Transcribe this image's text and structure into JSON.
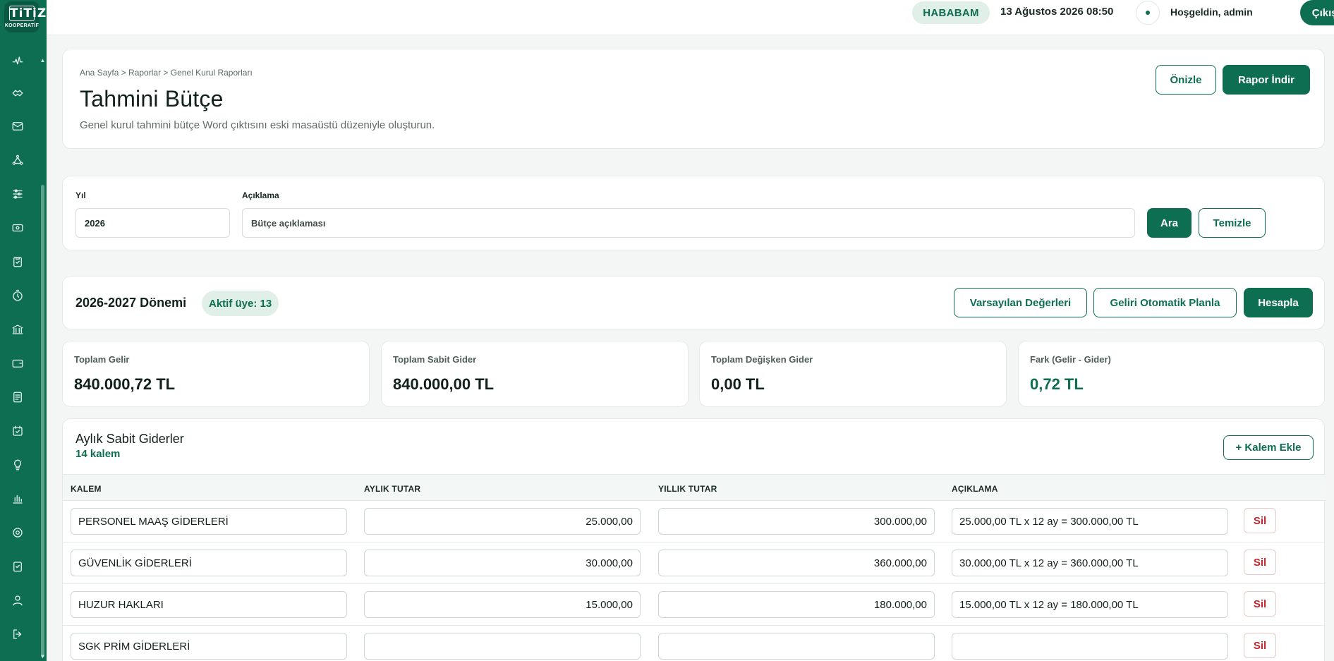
{
  "brand": {
    "logo_text": "TiTiZ",
    "logo_sub": "KOOPERATİF"
  },
  "sidebar": {
    "icons": [
      "activity-icon",
      "handshake-icon",
      "mail-icon",
      "network-icon",
      "sliders-icon",
      "money-icon",
      "clipboard-check-icon",
      "timer-icon",
      "bank-icon",
      "wallet-icon",
      "document-icon",
      "calendar-check-icon",
      "lightbulb-icon",
      "bar-chart-icon",
      "settings-icon",
      "task-icon",
      "user-icon",
      "logout-icon"
    ]
  },
  "topbar": {
    "org": "HABABAM",
    "datetime": "13 Ağustos 2026 08:50",
    "welcome": "Hoşgeldin, admin",
    "logout_label": "Çıkış Yap"
  },
  "header": {
    "breadcrumb": "Ana Sayfa > Raporlar > Genel Kurul Raporları",
    "title": "Tahmini Bütçe",
    "description": "Genel kurul tahmini bütçe Word çıktısını eski masaüstü düzeniyle oluşturun.",
    "preview_label": "Önizle",
    "download_label": "Rapor İndir"
  },
  "filters": {
    "year_label": "Yıl",
    "year_value": "2026",
    "desc_label": "Açıklama",
    "desc_placeholder": "Bütçe açıklaması",
    "search_label": "Ara",
    "clear_label": "Temizle"
  },
  "period": {
    "title": "2026-2027 Dönemi",
    "members_badge": "Aktif üye: 13",
    "defaults_label": "Varsayılan Değerleri",
    "auto_plan_label": "Geliri Otomatik Planla",
    "calculate_label": "Hesapla"
  },
  "stats": [
    {
      "label": "Toplam Gelir",
      "value": "840.000,72 TL"
    },
    {
      "label": "Toplam Sabit Gider",
      "value": "840.000,00 TL"
    },
    {
      "label": "Toplam Değişken Gider",
      "value": "0,00 TL"
    },
    {
      "label": "Fark (Gelir - Gider)",
      "value": "0,72 TL"
    }
  ],
  "fixed_expenses": {
    "title": "Aylık Sabit Giderler",
    "count": "14 kalem",
    "add_label": "+ Kalem Ekle",
    "columns": [
      "KALEM",
      "AYLIK TUTAR",
      "YILLIK TUTAR",
      "AÇIKLAMA"
    ],
    "delete_label": "Sil",
    "rows": [
      {
        "item": "PERSONEL MAAŞ GİDERLERİ",
        "monthly": "25.000,00",
        "yearly": "300.000,00",
        "note": "25.000,00 TL x 12 ay = 300.000,00 TL"
      },
      {
        "item": "GÜVENLİK GİDERLERİ",
        "monthly": "30.000,00",
        "yearly": "360.000,00",
        "note": "30.000,00 TL x 12 ay = 360.000,00 TL"
      },
      {
        "item": "HUZUR HAKLARI",
        "monthly": "15.000,00",
        "yearly": "180.000,00",
        "note": "15.000,00 TL x 12 ay = 180.000,00 TL"
      },
      {
        "item": "SGK PRİM GİDERLERİ",
        "monthly": "",
        "yearly": "",
        "note": ""
      }
    ]
  }
}
